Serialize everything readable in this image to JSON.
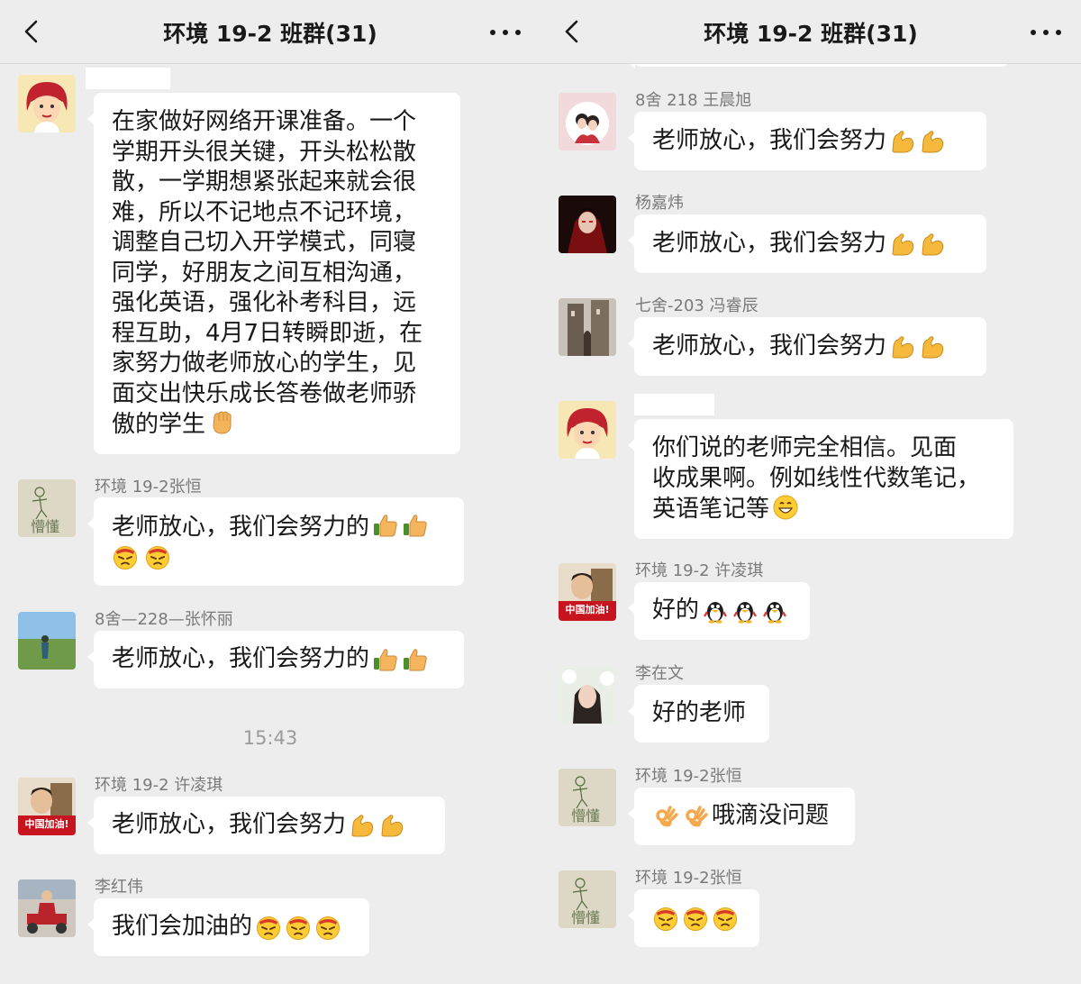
{
  "left": {
    "header": {
      "title": "环境 19-2 班群(31)"
    },
    "m1": {
      "text_lines": [
        "在家做好网络开课准备。一个",
        "学期开头很关键，开头松松散",
        "散，一学期想紧张起来就会很",
        "难，所以不记地点不记环境，",
        "调整自己切入开学模式，同寝",
        "同学，好朋友之间互相沟通，",
        "强化英语，强化补考科目，远",
        "程互助，4月7日转瞬即逝，在",
        "家努力做老师放心的学生，见",
        "面交出快乐成长答卷做老师骄",
        "傲的学生"
      ],
      "emoji": "fist-emoji"
    },
    "m2": {
      "name": "环境 19-2张恒",
      "text": "老师放心，我们会努力的",
      "emojis": [
        "thumbs-up-emoji",
        "thumbs-up-emoji",
        "annoyed-face-emoji",
        "annoyed-face-emoji"
      ]
    },
    "m3": {
      "name": "8舍—228—张怀丽",
      "text": "老师放心，我们会努力的",
      "emojis": [
        "thumbs-up-emoji",
        "thumbs-up-emoji"
      ]
    },
    "time": "15:43",
    "m4": {
      "name": "环境 19-2 许凌琪",
      "text": "老师放心，我们会努力",
      "avatar_text": "中国加油!",
      "emojis": [
        "flexed-biceps-emoji",
        "flexed-biceps-emoji"
      ]
    },
    "m5": {
      "name": "李红伟",
      "text": "我们会加油的",
      "emojis": [
        "annoyed-face-emoji",
        "annoyed-face-emoji",
        "annoyed-face-emoji"
      ]
    }
  },
  "right": {
    "header": {
      "title": "环境 19-2 班群(31)"
    },
    "r1": {
      "name": "8舍   218   王晨旭",
      "text": "老师放心，我们会努力",
      "emojis": [
        "flexed-biceps-emoji",
        "flexed-biceps-emoji"
      ]
    },
    "r2": {
      "name": "杨嘉炜",
      "text": "老师放心，我们会努力",
      "emojis": [
        "flexed-biceps-emoji",
        "flexed-biceps-emoji"
      ]
    },
    "r3": {
      "name": "七舍-203 冯睿辰",
      "text": "老师放心，我们会努力",
      "emojis": [
        "flexed-biceps-emoji",
        "flexed-biceps-emoji"
      ]
    },
    "r4": {
      "text_lines": [
        "你们说的老师完全相信。见面",
        "收成果啊。例如线性代数笔记，",
        "英语笔记等"
      ],
      "emoji": "grin-face-emoji"
    },
    "r5": {
      "name": "环境 19-2 许凌琪",
      "text": "好的",
      "avatar_text": "中国加油!",
      "emojis": [
        "penguin-emoji",
        "penguin-emoji",
        "penguin-emoji"
      ]
    },
    "r6": {
      "name": "李在文",
      "text": "好的老师"
    },
    "r7": {
      "name": "环境 19-2张恒",
      "text": "哦滴没问题",
      "emojis": [
        "ok-hand-emoji",
        "ok-hand-emoji"
      ]
    },
    "r8": {
      "name": "环境 19-2张恒",
      "emojis": [
        "annoyed-face-emoji",
        "annoyed-face-emoji",
        "annoyed-face-emoji"
      ]
    }
  },
  "theme": {
    "background": "#ededed",
    "bubble": "#ffffff",
    "text": "#191919",
    "name": "#7a7a7a"
  }
}
